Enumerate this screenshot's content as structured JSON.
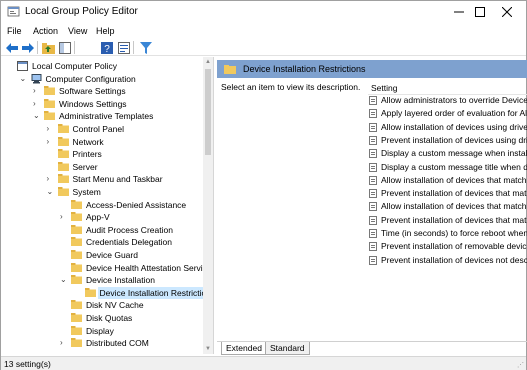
{
  "window": {
    "title": "Local Group Policy Editor"
  },
  "menu": [
    "File",
    "Action",
    "View",
    "Help"
  ],
  "toolbar": {
    "icons": [
      "back-arrow-icon",
      "forward-arrow-icon",
      "up-folder-icon",
      "show-hide-tree-icon",
      "help-icon",
      "properties-icon",
      "filter-icon"
    ]
  },
  "tree": [
    {
      "label": "Local Computer Policy",
      "indent": 0,
      "caret": "",
      "icon": "computer-policy-icon"
    },
    {
      "label": "Computer Configuration",
      "indent": 1,
      "caret": "v",
      "icon": "computer-icon"
    },
    {
      "label": "Software Settings",
      "indent": 2,
      "caret": ">",
      "icon": "folder-icon"
    },
    {
      "label": "Windows Settings",
      "indent": 2,
      "caret": ">",
      "icon": "folder-icon"
    },
    {
      "label": "Administrative Templates",
      "indent": 2,
      "caret": "v",
      "icon": "folder-icon"
    },
    {
      "label": "Control Panel",
      "indent": 3,
      "caret": ">",
      "icon": "folder-icon"
    },
    {
      "label": "Network",
      "indent": 3,
      "caret": ">",
      "icon": "folder-icon"
    },
    {
      "label": "Printers",
      "indent": 3,
      "caret": "",
      "icon": "folder-icon"
    },
    {
      "label": "Server",
      "indent": 3,
      "caret": "",
      "icon": "folder-icon"
    },
    {
      "label": "Start Menu and Taskbar",
      "indent": 3,
      "caret": ">",
      "icon": "folder-icon"
    },
    {
      "label": "System",
      "indent": 3,
      "caret": "v",
      "icon": "folder-icon"
    },
    {
      "label": "Access-Denied Assistance",
      "indent": 4,
      "caret": "",
      "icon": "folder-icon"
    },
    {
      "label": "App-V",
      "indent": 4,
      "caret": ">",
      "icon": "folder-icon"
    },
    {
      "label": "Audit Process Creation",
      "indent": 4,
      "caret": "",
      "icon": "folder-icon"
    },
    {
      "label": "Credentials Delegation",
      "indent": 4,
      "caret": "",
      "icon": "folder-icon"
    },
    {
      "label": "Device Guard",
      "indent": 4,
      "caret": "",
      "icon": "folder-icon"
    },
    {
      "label": "Device Health Attestation Service",
      "indent": 4,
      "caret": "",
      "icon": "folder-icon"
    },
    {
      "label": "Device Installation",
      "indent": 4,
      "caret": "v",
      "icon": "folder-icon"
    },
    {
      "label": "Device Installation Restrictions",
      "indent": 5,
      "caret": "",
      "icon": "folder-open-icon",
      "selected": true
    },
    {
      "label": "Disk NV Cache",
      "indent": 4,
      "caret": "",
      "icon": "folder-icon"
    },
    {
      "label": "Disk Quotas",
      "indent": 4,
      "caret": "",
      "icon": "folder-icon"
    },
    {
      "label": "Display",
      "indent": 4,
      "caret": "",
      "icon": "folder-icon"
    },
    {
      "label": "Distributed COM",
      "indent": 4,
      "caret": ">",
      "icon": "folder-icon"
    }
  ],
  "right": {
    "header": "Device Installation Restrictions",
    "description": "Select an item to view its description.",
    "column": "Setting",
    "settings": [
      "Allow administrators to override Device",
      "Apply layered order of evaluation for All",
      "Allow installation of devices using drive",
      "Prevent installation of devices using driv",
      "Display a custom message when install",
      "Display a custom message title when de",
      "Allow installation of devices that match",
      "Prevent installation of devices that mat",
      "Allow installation of devices that match",
      "Prevent installation of devices that mat",
      "Time (in seconds) to force reboot when",
      "Prevent installation of removable devic",
      "Prevent installation of devices not desc"
    ]
  },
  "tabs": [
    "Extended",
    "Standard"
  ],
  "status": "13 setting(s)"
}
